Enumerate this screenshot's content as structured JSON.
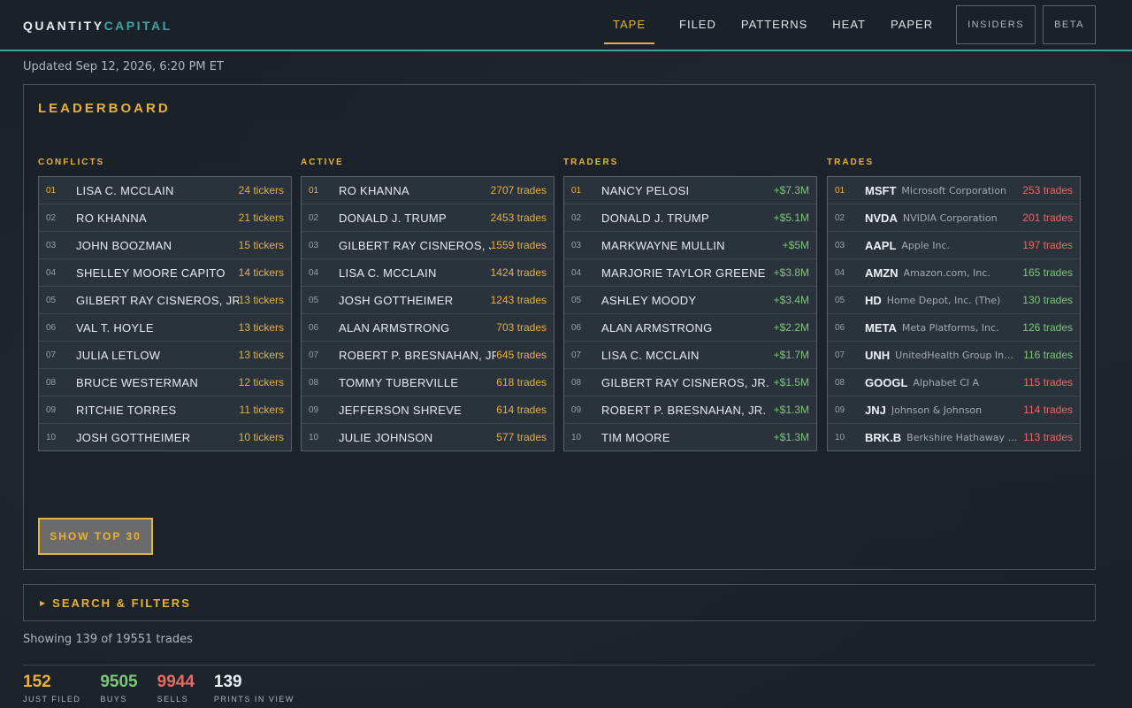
{
  "header": {
    "logo_a": "QUANTITY",
    "logo_b": "CAPITAL",
    "nav": [
      "TAPE",
      "FILED",
      "PATTERNS",
      "HEAT",
      "PAPER"
    ],
    "active_nav": "TAPE",
    "box_insiders": "INSIDERS",
    "box_beta": "BETA"
  },
  "updated": "Updated Sep 12, 2026, 6:20 PM ET",
  "board": {
    "title": "LEADERBOARD",
    "show_button": "SHOW TOP 30",
    "conflicts": {
      "title": "CONFLICTS",
      "rows": [
        {
          "rank": "01",
          "name": "LISA C. MCCLAIN",
          "value": "24 tickers"
        },
        {
          "rank": "02",
          "name": "RO KHANNA",
          "value": "21 tickers"
        },
        {
          "rank": "03",
          "name": "JOHN BOOZMAN",
          "value": "15 tickers"
        },
        {
          "rank": "04",
          "name": "SHELLEY MOORE CAPITO",
          "value": "14 tickers"
        },
        {
          "rank": "05",
          "name": "GILBERT RAY CISNEROS, JR.",
          "value": "13 tickers"
        },
        {
          "rank": "06",
          "name": "VAL T. HOYLE",
          "value": "13 tickers"
        },
        {
          "rank": "07",
          "name": "JULIA LETLOW",
          "value": "13 tickers"
        },
        {
          "rank": "08",
          "name": "BRUCE WESTERMAN",
          "value": "12 tickers"
        },
        {
          "rank": "09",
          "name": "RITCHIE TORRES",
          "value": "11 tickers"
        },
        {
          "rank": "10",
          "name": "JOSH GOTTHEIMER",
          "value": "10 tickers"
        }
      ]
    },
    "active": {
      "title": "ACTIVE",
      "rows": [
        {
          "rank": "01",
          "name": "RO KHANNA",
          "value": "2707 trades"
        },
        {
          "rank": "02",
          "name": "DONALD J. TRUMP",
          "value": "2453 trades"
        },
        {
          "rank": "03",
          "name": "GILBERT RAY CISNEROS, JR.",
          "value": "1559 trades"
        },
        {
          "rank": "04",
          "name": "LISA C. MCCLAIN",
          "value": "1424 trades"
        },
        {
          "rank": "05",
          "name": "JOSH GOTTHEIMER",
          "value": "1243 trades"
        },
        {
          "rank": "06",
          "name": "ALAN ARMSTRONG",
          "value": "703 trades"
        },
        {
          "rank": "07",
          "name": "ROBERT P. BRESNAHAN, JR.",
          "value": "645 trades"
        },
        {
          "rank": "08",
          "name": "TOMMY TUBERVILLE",
          "value": "618 trades"
        },
        {
          "rank": "09",
          "name": "JEFFERSON SHREVE",
          "value": "614 trades"
        },
        {
          "rank": "10",
          "name": "JULIE JOHNSON",
          "value": "577 trades"
        }
      ]
    },
    "traders": {
      "title": "TRADERS",
      "rows": [
        {
          "rank": "01",
          "name": "NANCY PELOSI",
          "value": "+$7.3M"
        },
        {
          "rank": "02",
          "name": "DONALD J. TRUMP",
          "value": "+$5.1M"
        },
        {
          "rank": "03",
          "name": "MARKWAYNE MULLIN",
          "value": "+$5M"
        },
        {
          "rank": "04",
          "name": "MARJORIE TAYLOR GREENE",
          "value": "+$3.8M"
        },
        {
          "rank": "05",
          "name": "ASHLEY MOODY",
          "value": "+$3.4M"
        },
        {
          "rank": "06",
          "name": "ALAN ARMSTRONG",
          "value": "+$2.2M"
        },
        {
          "rank": "07",
          "name": "LISA C. MCCLAIN",
          "value": "+$1.7M"
        },
        {
          "rank": "08",
          "name": "GILBERT RAY CISNEROS, JR.",
          "value": "+$1.5M"
        },
        {
          "rank": "09",
          "name": "ROBERT P. BRESNAHAN, JR.",
          "value": "+$1.3M"
        },
        {
          "rank": "10",
          "name": "TIM MOORE",
          "value": "+$1.3M"
        }
      ]
    },
    "trades": {
      "title": "TRADES",
      "rows": [
        {
          "rank": "01",
          "ticker": "MSFT",
          "company": "Microsoft Corporation",
          "value": "253 trades",
          "tone": "r"
        },
        {
          "rank": "02",
          "ticker": "NVDA",
          "company": "NVIDIA Corporation",
          "value": "201 trades",
          "tone": "r"
        },
        {
          "rank": "03",
          "ticker": "AAPL",
          "company": "Apple Inc.",
          "value": "197 trades",
          "tone": "r"
        },
        {
          "rank": "04",
          "ticker": "AMZN",
          "company": "Amazon.com, Inc.",
          "value": "165 trades",
          "tone": "g"
        },
        {
          "rank": "05",
          "ticker": "HD",
          "company": "Home Depot, Inc. (The)",
          "value": "130 trades",
          "tone": "g"
        },
        {
          "rank": "06",
          "ticker": "META",
          "company": "Meta Platforms, Inc.",
          "value": "126 trades",
          "tone": "g"
        },
        {
          "rank": "07",
          "ticker": "UNH",
          "company": "UnitedHealth Group Incor...",
          "value": "116 trades",
          "tone": "g"
        },
        {
          "rank": "08",
          "ticker": "GOOGL",
          "company": "Alphabet Cl A",
          "value": "115 trades",
          "tone": "r"
        },
        {
          "rank": "09",
          "ticker": "JNJ",
          "company": "Johnson & Johnson",
          "value": "114 trades",
          "tone": "r"
        },
        {
          "rank": "10",
          "ticker": "BRK.B",
          "company": "Berkshire Hathaway Inc....",
          "value": "113 trades",
          "tone": "r"
        }
      ]
    }
  },
  "filters": {
    "label": "SEARCH & FILTERS",
    "icon": "triangle-right-icon"
  },
  "showing": "Showing 139 of 19551 trades",
  "stats": [
    {
      "value": "152",
      "label": "JUST FILED",
      "color": "#e8b13a"
    },
    {
      "value": "9505",
      "label": "BUYS",
      "color": "#7cc77a"
    },
    {
      "value": "9944",
      "label": "SELLS",
      "color": "#e96a5f"
    },
    {
      "value": "139",
      "label": "PRINTS IN VIEW",
      "color": "#eef1f5"
    }
  ]
}
